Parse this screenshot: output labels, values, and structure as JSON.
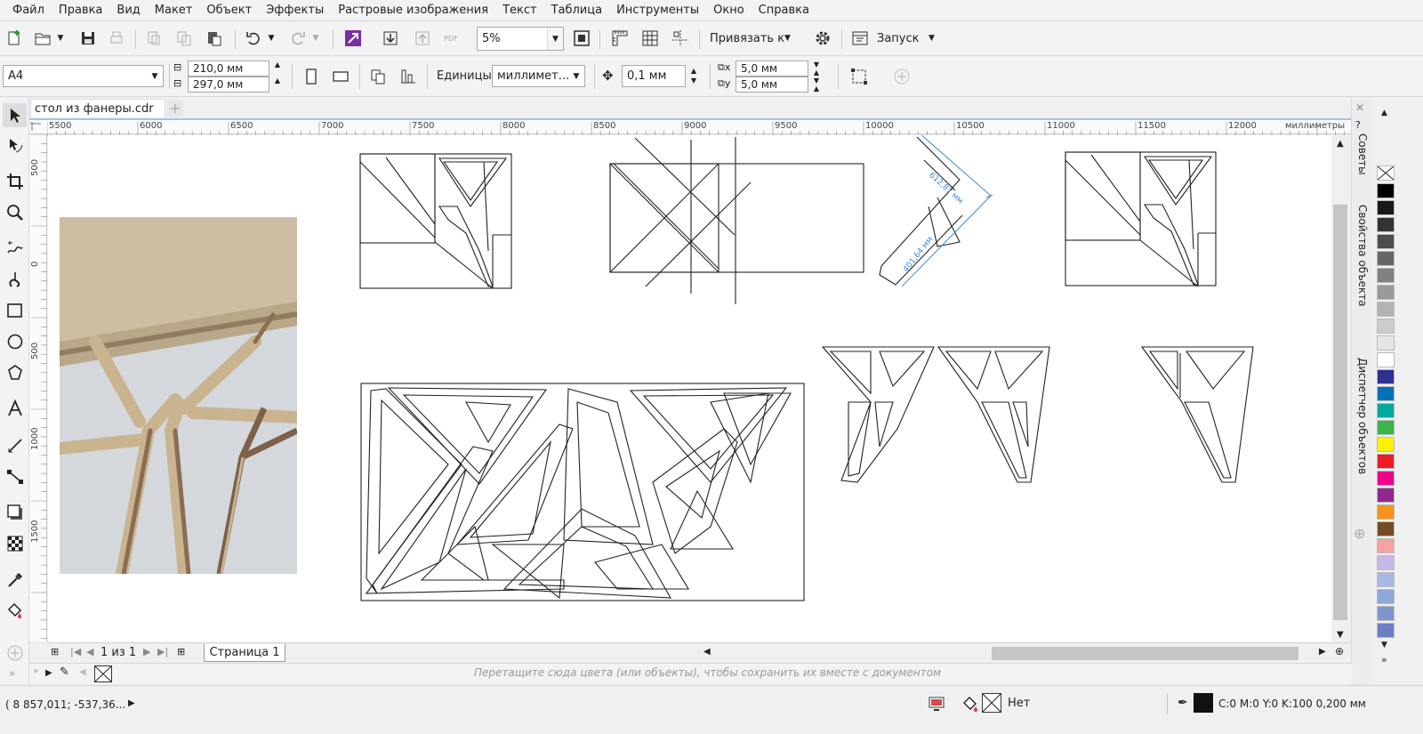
{
  "menu": [
    "Файл",
    "Правка",
    "Вид",
    "Макет",
    "Объект",
    "Эффекты",
    "Растровые изображения",
    "Текст",
    "Таблица",
    "Инструменты",
    "Окно",
    "Справка"
  ],
  "toolbar": {
    "zoom_value": "5%",
    "snap_label": "Привязать к",
    "launch_label": "Запуск"
  },
  "propbar": {
    "page_size": "A4",
    "width_value": "210,0 мм",
    "height_value": "297,0 мм",
    "units_label": "Единицы:",
    "units_value": "миллимет...",
    "nudge_value": "0,1 мм",
    "dup_x_value": "5,0 мм",
    "dup_y_value": "5,0 мм"
  },
  "document": {
    "tab_title": "стол из фанеры.cdr"
  },
  "ruler": {
    "unit_label": "миллиметры",
    "h_ticks": [
      "5500",
      "6000",
      "6500",
      "7000",
      "7500",
      "8000",
      "8500",
      "9000",
      "9500",
      "10000",
      "10500",
      "11000",
      "11500",
      "12000"
    ],
    "v_ticks": [
      "500",
      "0",
      "500",
      "1000",
      "1500"
    ]
  },
  "drawing": {
    "dimension_1": "612,87 мм",
    "dimension_2": "401,64 мм"
  },
  "dockers": {
    "tips": "Советы",
    "object_props": "Свойства объекта",
    "object_manager": "Диспетчер объектов"
  },
  "pagenav": {
    "page_counter": "1 из 1",
    "page_tab": "Страница 1"
  },
  "docpalette": {
    "hint": "Перетащите сюда цвета (или объекты), чтобы сохранить их вместе с документом"
  },
  "status": {
    "cursor_coords": "( 8 857,011; -537,36...",
    "fill_label": "Нет",
    "outline_label": "C:0 M:0 Y:0 K:100  0,200 мм"
  },
  "colors": {
    "accent": "#7a2ea8",
    "ruler_highlight": "#9ec5ea",
    "palette": [
      "#000000",
      "#1a1a1a",
      "#333333",
      "#4d4d4d",
      "#666666",
      "#808080",
      "#999999",
      "#b3b3b3",
      "#cccccc",
      "#e6e6e6",
      "#ffffff",
      "#2e3192",
      "#0071bc",
      "#00a99d",
      "#39b54a",
      "#fff200",
      "#ed1c24",
      "#ec008c",
      "#92278f",
      "#f7941d",
      "#754c24",
      "#f5a3a3",
      "#c7b9e6",
      "#a6b8e6",
      "#8fa8db",
      "#7d94cf",
      "#6b7fc2"
    ]
  }
}
